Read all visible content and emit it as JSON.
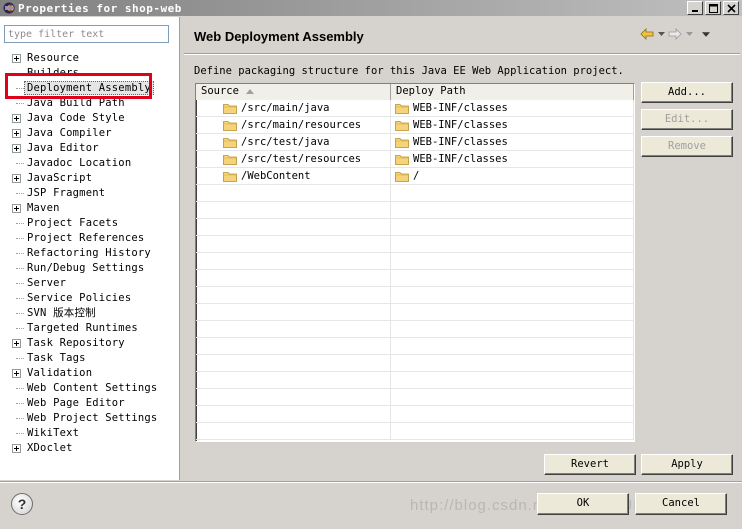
{
  "window": {
    "title": "Properties for shop-web",
    "minimize_label": "_",
    "maximize_label": "□",
    "close_label": "✕"
  },
  "filter": {
    "placeholder": "type filter text"
  },
  "tree": {
    "items": [
      {
        "label": "Resource",
        "expandable": true
      },
      {
        "label": "Builders",
        "expandable": false
      },
      {
        "label": "Deployment Assembly",
        "expandable": false,
        "selected": true
      },
      {
        "label": "Java Build Path",
        "expandable": false
      },
      {
        "label": "Java Code Style",
        "expandable": true
      },
      {
        "label": "Java Compiler",
        "expandable": true
      },
      {
        "label": "Java Editor",
        "expandable": true
      },
      {
        "label": "Javadoc Location",
        "expandable": false
      },
      {
        "label": "JavaScript",
        "expandable": true
      },
      {
        "label": "JSP Fragment",
        "expandable": false
      },
      {
        "label": "Maven",
        "expandable": true
      },
      {
        "label": "Project Facets",
        "expandable": false
      },
      {
        "label": "Project References",
        "expandable": false
      },
      {
        "label": "Refactoring History",
        "expandable": false
      },
      {
        "label": "Run/Debug Settings",
        "expandable": false
      },
      {
        "label": "Server",
        "expandable": false
      },
      {
        "label": "Service Policies",
        "expandable": false
      },
      {
        "label": "SVN 版本控制",
        "expandable": false
      },
      {
        "label": "Targeted Runtimes",
        "expandable": false
      },
      {
        "label": "Task Repository",
        "expandable": true
      },
      {
        "label": "Task Tags",
        "expandable": false
      },
      {
        "label": "Validation",
        "expandable": true
      },
      {
        "label": "Web Content Settings",
        "expandable": false
      },
      {
        "label": "Web Page Editor",
        "expandable": false
      },
      {
        "label": "Web Project Settings",
        "expandable": false
      },
      {
        "label": "WikiText",
        "expandable": false
      },
      {
        "label": "XDoclet",
        "expandable": true
      }
    ]
  },
  "page": {
    "title": "Web Deployment Assembly",
    "description": "Define packaging structure for this Java EE Web Application project."
  },
  "grid": {
    "columns": [
      "Source",
      "Deploy Path"
    ],
    "rows": [
      {
        "source": "/src/main/java",
        "deploy": "WEB-INF/classes"
      },
      {
        "source": "/src/main/resources",
        "deploy": "WEB-INF/classes"
      },
      {
        "source": "/src/test/java",
        "deploy": "WEB-INF/classes"
      },
      {
        "source": "/src/test/resources",
        "deploy": "WEB-INF/classes"
      },
      {
        "source": "/WebContent",
        "deploy": "/"
      }
    ]
  },
  "buttons": {
    "add": "Add...",
    "edit": "Edit...",
    "remove": "Remove",
    "revert": "Revert",
    "apply": "Apply",
    "ok": "OK",
    "cancel": "Cancel"
  },
  "help": {
    "glyph": "?"
  },
  "watermark": "http://blog.csdn.net/...ANGJUN"
}
